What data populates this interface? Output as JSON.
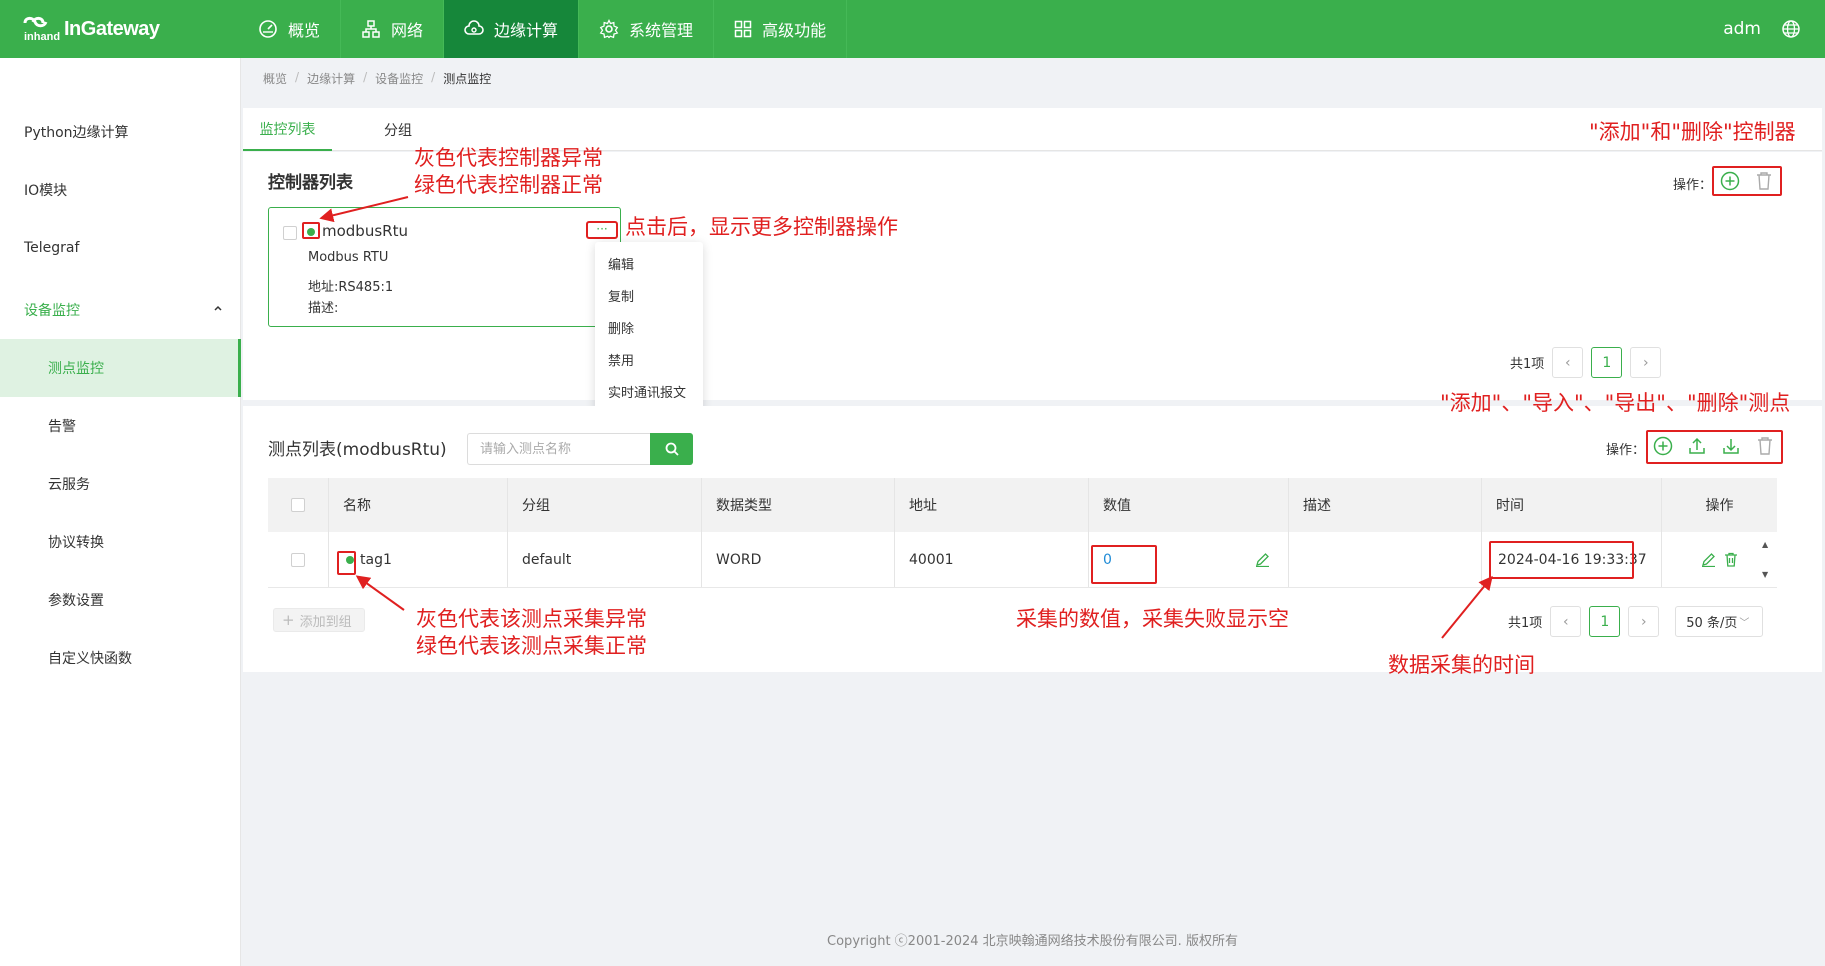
{
  "header": {
    "brand": "InGateway",
    "brand_small": "inhand",
    "nav": [
      {
        "label": "概览",
        "icon": "dashboard-icon"
      },
      {
        "label": "网络",
        "icon": "network-icon"
      },
      {
        "label": "边缘计算",
        "icon": "cloud-icon",
        "active": true
      },
      {
        "label": "系统管理",
        "icon": "gear-icon"
      },
      {
        "label": "高级功能",
        "icon": "grid-icon"
      }
    ],
    "user": "adm",
    "lang_icon": "globe-icon",
    "accent": "#3aaf4c"
  },
  "sidebar": {
    "items": [
      {
        "label": "Python边缘计算"
      },
      {
        "label": "IO模块"
      },
      {
        "label": "Telegraf"
      },
      {
        "label": "设备监控",
        "open": true
      },
      {
        "label": "测点监控",
        "active": true
      },
      {
        "label": "告警"
      },
      {
        "label": "云服务"
      },
      {
        "label": "协议转换"
      },
      {
        "label": "参数设置"
      },
      {
        "label": "自定义快函数"
      }
    ]
  },
  "breadcrumb": [
    "概览",
    "边缘计算",
    "设备监控",
    "测点监控"
  ],
  "tabs": [
    {
      "label": "监控列表",
      "active": true
    },
    {
      "label": "分组"
    }
  ],
  "controllers": {
    "title": "控制器列表",
    "ops_label": "操作：",
    "card": {
      "name": "modbusRtu",
      "protocol": "Modbus RTU",
      "address": "地址:RS485:1",
      "desc": "描述:",
      "more": "···"
    },
    "menu": [
      "编辑",
      "复制",
      "删除",
      "禁用",
      "实时通讯报文"
    ],
    "pager": {
      "total": "共1项",
      "page": "1"
    }
  },
  "points": {
    "title": "测点列表(modbusRtu)",
    "search_placeholder": "请输入测点名称",
    "ops_label": "操作：",
    "columns": [
      "名称",
      "分组",
      "数据类型",
      "地址",
      "数值",
      "描述",
      "时间",
      "操作"
    ],
    "rows": [
      {
        "name": "tag1",
        "group": "default",
        "type": "WORD",
        "address": "40001",
        "value": "0",
        "desc": "",
        "time": "2024-04-16 19:33:37"
      }
    ],
    "add_to_group": "添加到组",
    "pager": {
      "total": "共1项",
      "page": "1",
      "size": "50 条/页"
    }
  },
  "footer": "Copyright ⓒ2001-2024 北京映翰通网络技术股份有限公司. 版权所有",
  "annotations": {
    "ctrl_status": [
      "灰色代表控制器异常",
      "绿色代表控制器正常"
    ],
    "more_ops": "点击后，显示更多控制器操作",
    "add_delete_ctrl": "\"添加\"和\"删除\"控制器",
    "point_ops": "\"添加\"、\"导入\"、\"导出\"、\"删除\"测点",
    "point_status": [
      "灰色代表该测点采集异常",
      "绿色代表该测点采集正常"
    ],
    "value_note": "采集的数值，采集失败显示空",
    "time_note": "数据采集的时间",
    "color": "#e02020"
  }
}
